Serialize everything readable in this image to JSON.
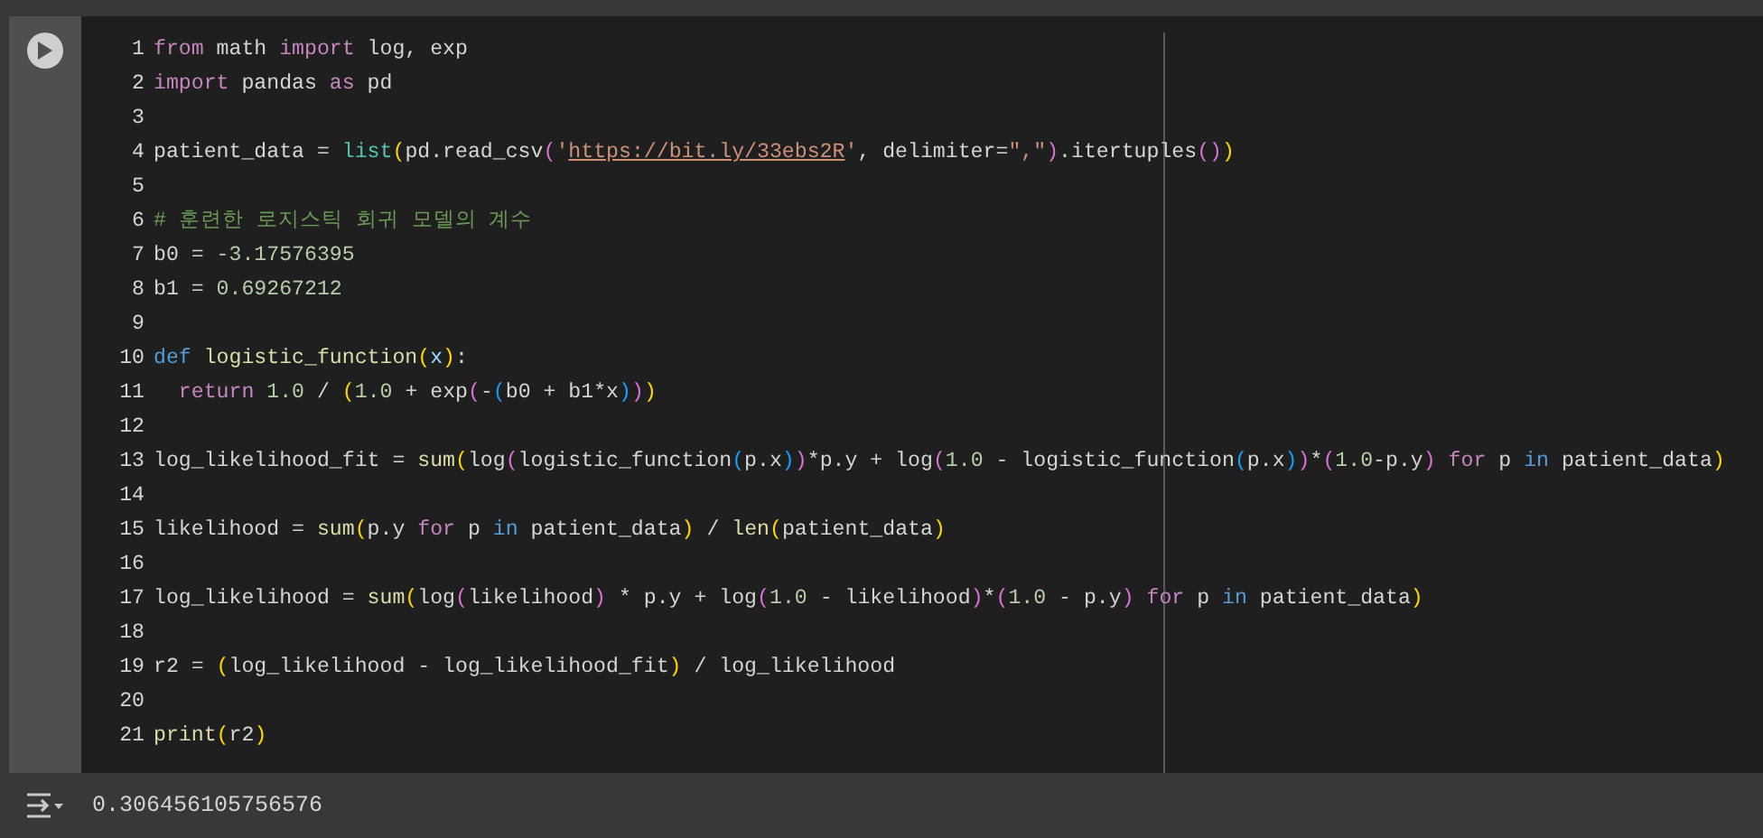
{
  "cell": {
    "lines": [
      {
        "number": "1",
        "tokens": [
          {
            "text": "from",
            "kind": "keyword"
          },
          {
            "text": " math ",
            "kind": "plain"
          },
          {
            "text": "import",
            "kind": "keyword"
          },
          {
            "text": " log, exp",
            "kind": "plain"
          }
        ]
      },
      {
        "number": "2",
        "tokens": [
          {
            "text": "import",
            "kind": "keyword"
          },
          {
            "text": " pandas ",
            "kind": "plain"
          },
          {
            "text": "as",
            "kind": "keyword"
          },
          {
            "text": " pd",
            "kind": "plain"
          }
        ]
      },
      {
        "number": "3"
      },
      {
        "number": "4",
        "tokens": [
          {
            "text": "patient_data = ",
            "kind": "plain"
          },
          {
            "text": "list",
            "kind": "builtin"
          },
          {
            "text": "(",
            "kind": "bracket1"
          },
          {
            "text": "pd.read_csv",
            "kind": "plain"
          },
          {
            "text": "(",
            "kind": "bracket2"
          },
          {
            "text": "'",
            "kind": "string"
          },
          {
            "text": "https://bit.ly/33ebs2R",
            "kind": "link"
          },
          {
            "text": "'",
            "kind": "string"
          },
          {
            "text": ", delimiter=",
            "kind": "plain"
          },
          {
            "text": "\",\"",
            "kind": "string"
          },
          {
            "text": ")",
            "kind": "bracket2"
          },
          {
            "text": ".itertuples",
            "kind": "plain"
          },
          {
            "text": "()",
            "kind": "bracket2"
          },
          {
            "text": ")",
            "kind": "bracket1"
          }
        ]
      },
      {
        "number": "5"
      },
      {
        "number": "6",
        "tokens": [
          {
            "text": "# 훈련한 로지스틱 회귀 모델의 계수",
            "kind": "comment"
          }
        ]
      },
      {
        "number": "7",
        "tokens": [
          {
            "text": "b0 = ",
            "kind": "plain"
          },
          {
            "text": "-3.17576395",
            "kind": "number"
          }
        ]
      },
      {
        "number": "8",
        "tokens": [
          {
            "text": "b1 = ",
            "kind": "plain"
          },
          {
            "text": "0.69267212",
            "kind": "number"
          }
        ]
      },
      {
        "number": "9"
      },
      {
        "number": "10",
        "tokens": [
          {
            "text": "def",
            "kind": "storage"
          },
          {
            "text": " logistic_function",
            "kind": "function"
          },
          {
            "text": "(",
            "kind": "bracket1"
          },
          {
            "text": "x",
            "kind": "param"
          },
          {
            "text": ")",
            "kind": "bracket1"
          },
          {
            "text": ":",
            "kind": "plain"
          }
        ]
      },
      {
        "number": "11",
        "tokens": [
          {
            "text": "  return",
            "kind": "keyword"
          },
          {
            "text": " 1.0",
            "kind": "number"
          },
          {
            "text": " / ",
            "kind": "plain"
          },
          {
            "text": "(",
            "kind": "bracket1"
          },
          {
            "text": "1.0",
            "kind": "number"
          },
          {
            "text": " + exp",
            "kind": "plain"
          },
          {
            "text": "(",
            "kind": "bracket2"
          },
          {
            "text": "-",
            "kind": "plain"
          },
          {
            "text": "(",
            "kind": "bracket3"
          },
          {
            "text": "b0 + b1*x",
            "kind": "plain"
          },
          {
            "text": ")",
            "kind": "bracket3"
          },
          {
            "text": ")",
            "kind": "bracket2"
          },
          {
            "text": ")",
            "kind": "bracket1"
          }
        ]
      },
      {
        "number": "12"
      },
      {
        "number": "13",
        "tokens": [
          {
            "text": "log_likelihood_fit = ",
            "kind": "plain"
          },
          {
            "text": "sum",
            "kind": "function"
          },
          {
            "text": "(",
            "kind": "bracket1"
          },
          {
            "text": "log",
            "kind": "plain"
          },
          {
            "text": "(",
            "kind": "bracket2"
          },
          {
            "text": "logistic_function",
            "kind": "plain"
          },
          {
            "text": "(",
            "kind": "bracket3"
          },
          {
            "text": "p.x",
            "kind": "plain"
          },
          {
            "text": ")",
            "kind": "bracket3"
          },
          {
            "text": ")",
            "kind": "bracket2"
          },
          {
            "text": "*p.y + log",
            "kind": "plain"
          },
          {
            "text": "(",
            "kind": "bracket2"
          },
          {
            "text": "1.0",
            "kind": "number"
          },
          {
            "text": " - logistic_function",
            "kind": "plain"
          },
          {
            "text": "(",
            "kind": "bracket3"
          },
          {
            "text": "p.x",
            "kind": "plain"
          },
          {
            "text": ")",
            "kind": "bracket3"
          },
          {
            "text": ")",
            "kind": "bracket2"
          },
          {
            "text": "*",
            "kind": "plain"
          },
          {
            "text": "(",
            "kind": "bracket2"
          },
          {
            "text": "1.0",
            "kind": "number"
          },
          {
            "text": "-p.y",
            "kind": "plain"
          },
          {
            "text": ")",
            "kind": "bracket2"
          },
          {
            "text": " for",
            "kind": "keyword"
          },
          {
            "text": " p ",
            "kind": "plain"
          },
          {
            "text": "in",
            "kind": "storage"
          },
          {
            "text": " patient_data",
            "kind": "plain"
          },
          {
            "text": ")",
            "kind": "bracket1"
          }
        ]
      },
      {
        "number": "14"
      },
      {
        "number": "15",
        "tokens": [
          {
            "text": "likelihood = ",
            "kind": "plain"
          },
          {
            "text": "sum",
            "kind": "function"
          },
          {
            "text": "(",
            "kind": "bracket1"
          },
          {
            "text": "p.y ",
            "kind": "plain"
          },
          {
            "text": "for",
            "kind": "keyword"
          },
          {
            "text": " p ",
            "kind": "plain"
          },
          {
            "text": "in",
            "kind": "storage"
          },
          {
            "text": " patient_data",
            "kind": "plain"
          },
          {
            "text": ")",
            "kind": "bracket1"
          },
          {
            "text": " / ",
            "kind": "plain"
          },
          {
            "text": "len",
            "kind": "function"
          },
          {
            "text": "(",
            "kind": "bracket1"
          },
          {
            "text": "patient_data",
            "kind": "plain"
          },
          {
            "text": ")",
            "kind": "bracket1"
          }
        ]
      },
      {
        "number": "16"
      },
      {
        "number": "17",
        "tokens": [
          {
            "text": "log_likelihood = ",
            "kind": "plain"
          },
          {
            "text": "sum",
            "kind": "function"
          },
          {
            "text": "(",
            "kind": "bracket1"
          },
          {
            "text": "log",
            "kind": "plain"
          },
          {
            "text": "(",
            "kind": "bracket2"
          },
          {
            "text": "likelihood",
            "kind": "plain"
          },
          {
            "text": ")",
            "kind": "bracket2"
          },
          {
            "text": " * p.y + log",
            "kind": "plain"
          },
          {
            "text": "(",
            "kind": "bracket2"
          },
          {
            "text": "1.0",
            "kind": "number"
          },
          {
            "text": " - likelihood",
            "kind": "plain"
          },
          {
            "text": ")",
            "kind": "bracket2"
          },
          {
            "text": "*",
            "kind": "plain"
          },
          {
            "text": "(",
            "kind": "bracket2"
          },
          {
            "text": "1.0",
            "kind": "number"
          },
          {
            "text": " - p.y",
            "kind": "plain"
          },
          {
            "text": ")",
            "kind": "bracket2"
          },
          {
            "text": " for",
            "kind": "keyword"
          },
          {
            "text": " p ",
            "kind": "plain"
          },
          {
            "text": "in",
            "kind": "storage"
          },
          {
            "text": " patient_data",
            "kind": "plain"
          },
          {
            "text": ")",
            "kind": "bracket1"
          }
        ]
      },
      {
        "number": "18"
      },
      {
        "number": "19",
        "tokens": [
          {
            "text": "r2 = ",
            "kind": "plain"
          },
          {
            "text": "(",
            "kind": "bracket1"
          },
          {
            "text": "log_likelihood - log_likelihood_fit",
            "kind": "plain"
          },
          {
            "text": ")",
            "kind": "bracket1"
          },
          {
            "text": " / log_likelihood",
            "kind": "plain"
          }
        ]
      },
      {
        "number": "20"
      },
      {
        "number": "21",
        "tokens": [
          {
            "text": "print",
            "kind": "function"
          },
          {
            "text": "(",
            "kind": "bracket1"
          },
          {
            "text": "r2",
            "kind": "plain"
          },
          {
            "text": ")",
            "kind": "bracket1"
          }
        ]
      }
    ]
  },
  "output": {
    "text": "0.306456105756576"
  }
}
